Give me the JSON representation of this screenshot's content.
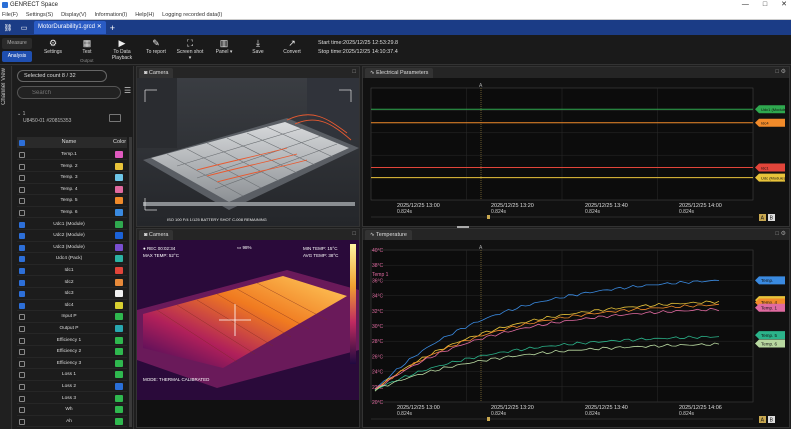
{
  "window": {
    "title": "GENRECT Space",
    "controls": [
      "—",
      "□",
      "✕"
    ]
  },
  "menu": [
    "File(F)",
    "Settings(S)",
    "Display(V)",
    "Information(I)",
    "Help(H)",
    "Logging recorded data(I)"
  ],
  "tabs": {
    "document": "MotorDurability1.grcd ✕",
    "add": "+"
  },
  "ribbon": {
    "modes": [
      "Measure",
      "Analysis"
    ],
    "buttons": [
      {
        "icon": "gear-icon",
        "glyph": "⚙",
        "label": "Settings"
      },
      {
        "icon": "test-icon",
        "glyph": "▦",
        "label": "Test"
      },
      {
        "icon": "play-icon",
        "glyph": "▶",
        "label": "To Data Playback"
      },
      {
        "icon": "report-icon",
        "glyph": "✎",
        "label": "To report"
      },
      {
        "icon": "screenshot-icon",
        "glyph": "⛶",
        "label": "Screen shot ▾"
      },
      {
        "icon": "panel-icon",
        "glyph": "▥",
        "label": "Panel ▾"
      },
      {
        "icon": "save-icon",
        "glyph": "⤓",
        "label": "Save"
      },
      {
        "icon": "convert-icon",
        "glyph": "↗",
        "label": "Convert"
      }
    ],
    "group_output": "Output",
    "start_time": "Start time:2025/12/25 12:53:29.8",
    "stop_time": "Stop time:2025/12/25 14:10:37.4"
  },
  "sidetab": "Channel View",
  "channels": {
    "selected": "Selected count 8 / 32",
    "search_placeholder": "Search",
    "device_index": "1",
    "device_name": "U8450-01 #20815353",
    "header_name": "Name",
    "header_color": "Color",
    "items": [
      {
        "name": "Temp.1",
        "checked": false,
        "color": "#e05abf"
      },
      {
        "name": "Temp. 2",
        "checked": false,
        "color": "#e8c33a"
      },
      {
        "name": "Temp. 3",
        "checked": false,
        "color": "#6ec6e8"
      },
      {
        "name": "Temp. 4",
        "checked": false,
        "color": "#e06aa0"
      },
      {
        "name": "Temp. 5",
        "checked": false,
        "color": "#f08a2a"
      },
      {
        "name": "Temp. 6",
        "checked": false,
        "color": "#3a8ae0"
      },
      {
        "name": "Udc1 (Module)",
        "checked": true,
        "color": "#2fa84f"
      },
      {
        "name": "Udc2 (Module)",
        "checked": true,
        "color": "#1b62d8"
      },
      {
        "name": "Udc3 (Module)",
        "checked": true,
        "color": "#7a4fd0"
      },
      {
        "name": "Udc4 (Pack)",
        "checked": true,
        "color": "#2bb3a3"
      },
      {
        "name": "Idc1",
        "checked": true,
        "color": "#e2453a"
      },
      {
        "name": "Idc2",
        "checked": true,
        "color": "#e88a3a"
      },
      {
        "name": "Idc3",
        "checked": true,
        "color": "#f0f0f0"
      },
      {
        "name": "Idc4",
        "checked": true,
        "color": "#d8d030"
      },
      {
        "name": "Input P",
        "checked": false,
        "color": "#2fb84f"
      },
      {
        "name": "Output P",
        "checked": false,
        "color": "#28a8b0"
      },
      {
        "name": "Efficiency 1",
        "checked": false,
        "color": "#2fb84f"
      },
      {
        "name": "Efficiency 2",
        "checked": false,
        "color": "#2fb84f"
      },
      {
        "name": "Efficiency 3",
        "checked": false,
        "color": "#2fb84f"
      },
      {
        "name": "Loss 1",
        "checked": false,
        "color": "#2fb84f"
      },
      {
        "name": "Loss 2",
        "checked": false,
        "color": "#2a6fd8"
      },
      {
        "name": "Loss 3",
        "checked": false,
        "color": "#2fb84f"
      },
      {
        "name": "Wh",
        "checked": false,
        "color": "#2fb84f"
      },
      {
        "name": "Ah",
        "checked": false,
        "color": "#2fb84f"
      }
    ]
  },
  "camera1": {
    "tab": "Camera",
    "overlay": "ISO 100   F/4   1/125   BATTERY   SHOT C-008   REMAINING"
  },
  "camera2": {
    "tab": "Camera",
    "rec": "● REC 00:02:34",
    "max": "MAX TEMP: 52°C",
    "min": "MIN TEMP: 15°C",
    "avg": "AVG TEMP: 38°C",
    "battery": "98%",
    "mode": "MODE: THERMAL CALIBRATED"
  },
  "elec": {
    "tab": "Electrical Parameters",
    "marker": "A",
    "x_ticks": [
      "2025/12/25 13:00",
      "2025/12/25 13:20",
      "2025/12/25 13:40",
      "2025/12/25 14:00"
    ],
    "x_sub": "0.824s",
    "lines": [
      {
        "name": "Udc1 (Module)",
        "color": "#2fa84f",
        "y": 0.19
      },
      {
        "name": "Idc4",
        "color": "#f08a2a",
        "y": 0.31
      },
      {
        "name": "Idc1",
        "color": "#e2453a",
        "y": 0.71
      },
      {
        "name": "Udc (Module)",
        "color": "#e8c33a",
        "y": 0.8
      }
    ],
    "badges": {
      "a": "A",
      "b": "B"
    }
  },
  "temp": {
    "tab": "Temperature",
    "marker": "A",
    "y_ticks": [
      "40°C",
      "38°C",
      "36°C",
      "34°C",
      "32°C",
      "30°C",
      "28°C",
      "26°C",
      "24°C",
      "22°C",
      "20°C"
    ],
    "legend_label": "Temp 1",
    "x_ticks": [
      "2025/12/25 13:00",
      "2025/12/25 13:20",
      "2025/12/25 13:40",
      "2025/12/25 14:06"
    ],
    "x_sub": "0.824s",
    "series": [
      {
        "name": "Temp.",
        "color": "#3a8ae0",
        "end": 0.8
      },
      {
        "name": "Temp. 2",
        "color": "#e8c33a",
        "end": 0.66
      },
      {
        "name": "Temp. 4",
        "color": "#f08a2a",
        "end": 0.64
      },
      {
        "name": "Temp. 1",
        "color": "#e06aa0",
        "end": 0.61
      },
      {
        "name": "Temp. 5",
        "color": "#2bb38a",
        "end": 0.43
      },
      {
        "name": "Temp. 6",
        "color": "#b8d8a0",
        "end": 0.38
      }
    ],
    "badges": {
      "a": "A",
      "b": "B"
    }
  }
}
